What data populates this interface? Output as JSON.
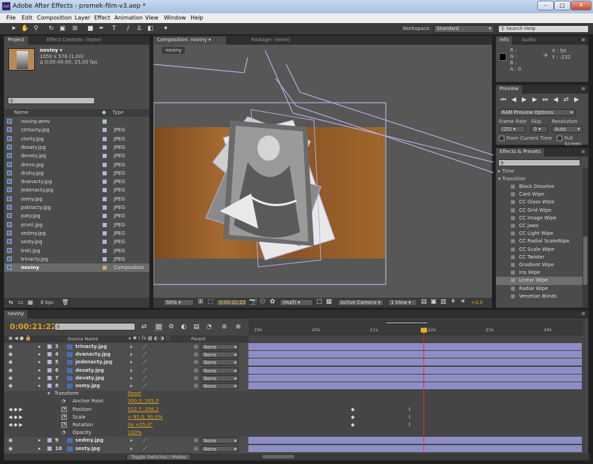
{
  "window": {
    "title": "Adobe After Effects - premek-film-v3.aep *",
    "app_icon": "Ae",
    "min": "–",
    "max": "□",
    "close": "✕"
  },
  "menu": [
    "File",
    "Edit",
    "Composition",
    "Layer",
    "Effect",
    "Animation",
    "View",
    "Window",
    "Help"
  ],
  "toolbar": {
    "workspace_label": "Workspace:",
    "workspace_value": "Standard",
    "search_help": "Search Help"
  },
  "project": {
    "tab_project": "Project",
    "tab_effect_controls": "Effect Controls: (none)",
    "item_name": "noviny ▾",
    "item_info1": "1050 x 576 (1,00)",
    "item_info2": "Δ 0:00:45:00, 25,00 fps",
    "col_name": "Name",
    "col_type": "Type",
    "items": [
      {
        "name": "noviny.wmv",
        "type": "",
        "color": "#9fd0a5",
        "italic": true
      },
      {
        "name": "ctrnacty.jpg",
        "type": "JPEG",
        "color": "#b4b4e0"
      },
      {
        "name": "ctvrty.jpg",
        "type": "JPEG",
        "color": "#b4b4e0"
      },
      {
        "name": "desaty.jpg",
        "type": "JPEG",
        "color": "#b4b4e0"
      },
      {
        "name": "devaty.jpg",
        "type": "JPEG",
        "color": "#b4b4e0"
      },
      {
        "name": "drevo.jpg",
        "type": "JPEG",
        "color": "#b4b4e0"
      },
      {
        "name": "druhy.jpg",
        "type": "JPEG",
        "color": "#b4b4e0"
      },
      {
        "name": "dvanacty.jpg",
        "type": "JPEG",
        "color": "#b4b4e0"
      },
      {
        "name": "jedenacty.jpg",
        "type": "JPEG",
        "color": "#b4b4e0"
      },
      {
        "name": "osmy.jpg",
        "type": "JPEG",
        "color": "#b4b4e0"
      },
      {
        "name": "patnacty.jpg",
        "type": "JPEG",
        "color": "#b4b4e0"
      },
      {
        "name": "paty.jpg",
        "type": "JPEG",
        "color": "#b4b4e0"
      },
      {
        "name": "prvni.jpg",
        "type": "JPEG",
        "color": "#b4b4e0"
      },
      {
        "name": "sedmy.jpg",
        "type": "JPEG",
        "color": "#b4b4e0"
      },
      {
        "name": "sesty.jpg",
        "type": "JPEG",
        "color": "#b4b4e0"
      },
      {
        "name": "treti.jpg",
        "type": "JPEG",
        "color": "#b4b4e0"
      },
      {
        "name": "trinacty.jpg",
        "type": "JPEG",
        "color": "#b4b4e0"
      },
      {
        "name": "noviny",
        "type": "Composition",
        "color": "#c8a86a",
        "selected": true
      }
    ],
    "bpc": "8 bpc"
  },
  "comp": {
    "tab_comp": "Composition: noviny",
    "tab_footage": "Footage: (none)",
    "subtab": "noviny",
    "zoom": "50%",
    "timecode": "0:00:21:22",
    "resolution": "(Half)",
    "camera": "Active Camera",
    "views": "1 View",
    "exposure": "+0,0"
  },
  "info": {
    "tab_info": "Info",
    "tab_audio": "Audio",
    "r": "R :",
    "g": "G :",
    "b": "B :",
    "a": "A : 0",
    "x": "X : 50",
    "y": "Y : -232"
  },
  "preview": {
    "tab": "Preview",
    "ram": "RAM Preview Options",
    "frame_rate_label": "Frame Rate",
    "skip_label": "Skip",
    "resolution_label": "Resolution",
    "frame_rate": "(25)",
    "skip": "0",
    "resolution": "Auto",
    "from_current": "From Current Time",
    "full_screen": "Full Screen"
  },
  "effects": {
    "tab": "Effects & Presets",
    "groups": [
      "Time",
      "Transition"
    ],
    "items": [
      "Block Dissolve",
      "Card Wipe",
      "CC Glass Wipe",
      "CC Grid Wipe",
      "CC Image Wipe",
      "CC Jaws",
      "CC Light Wipe",
      "CC Radial ScaleWipe",
      "CC Scale Wipe",
      "CC Twister",
      "Gradient Wipe",
      "Iris Wipe",
      "Linear Wipe",
      "Radial Wipe",
      "Venetian Blinds"
    ],
    "selected": "Linear Wipe"
  },
  "timeline": {
    "tab": "noviny",
    "timecode": "0:00:21:22",
    "col_source": "Source Name",
    "col_parent": "Parent",
    "ruler": [
      "19s",
      "20s",
      "21s",
      "22s",
      "23s",
      "24s"
    ],
    "layers": [
      {
        "num": "3",
        "name": "trinacty.jpg",
        "parent": "None"
      },
      {
        "num": "4",
        "name": "dvanacty.jpg",
        "parent": "None"
      },
      {
        "num": "5",
        "name": "jedenacty.jpg",
        "parent": "None"
      },
      {
        "num": "6",
        "name": "desaty.jpg",
        "parent": "None"
      },
      {
        "num": "7",
        "name": "devaty.jpg",
        "parent": "None"
      },
      {
        "num": "8",
        "name": "osmy.jpg",
        "parent": "None"
      }
    ],
    "transform": "Transform",
    "reset": "Reset",
    "props": [
      {
        "name": "Anchor Point",
        "value": "200,0, 265,5"
      },
      {
        "name": "Position",
        "value": "522,7, 258,2"
      },
      {
        "name": "Scale",
        "value": "∞ 91,0, 91,0%"
      },
      {
        "name": "Rotation",
        "value": "0x +25,0°"
      },
      {
        "name": "Opacity",
        "value": "100%"
      }
    ],
    "layers_bottom": [
      {
        "num": "9",
        "name": "sedmy.jpg",
        "parent": "None"
      },
      {
        "num": "10",
        "name": "sesty.jpg",
        "parent": "None"
      }
    ],
    "toggle": "Toggle Switches / Modes"
  }
}
